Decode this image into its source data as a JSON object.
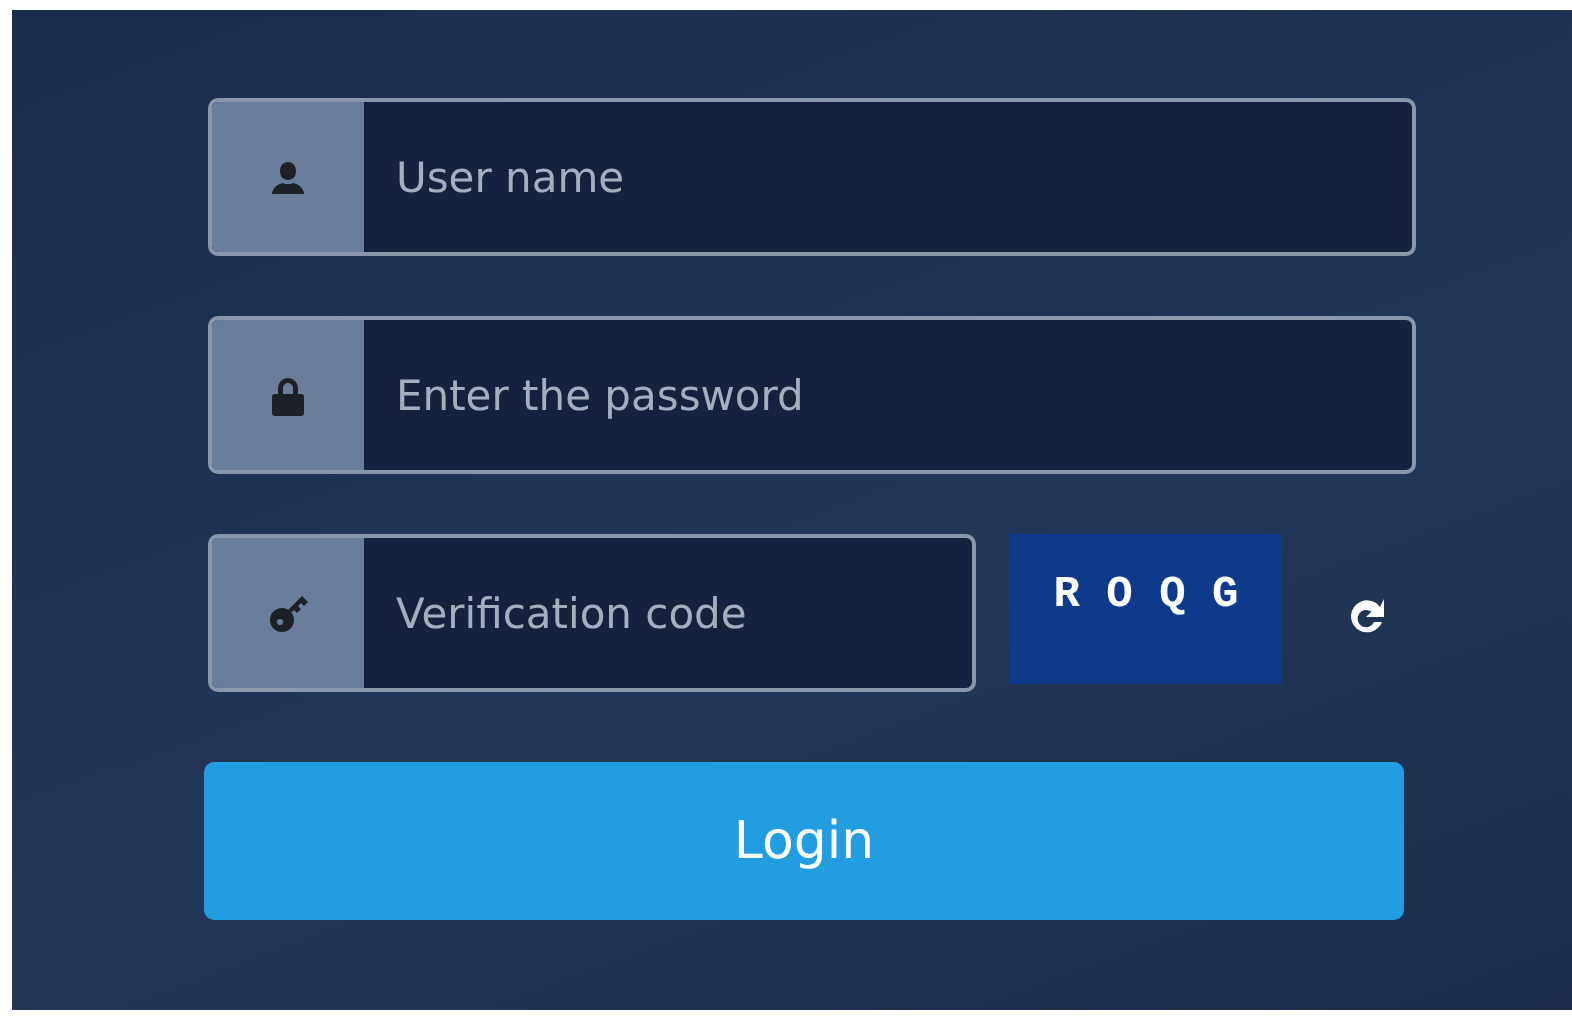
{
  "fields": [
    {
      "kind": "user",
      "placeholder": "User name"
    },
    {
      "kind": "password",
      "placeholder": "Enter the password"
    }
  ],
  "verification": {
    "placeholder": "Verification code",
    "captcha": "R O Q G"
  },
  "login_button": "Login"
}
